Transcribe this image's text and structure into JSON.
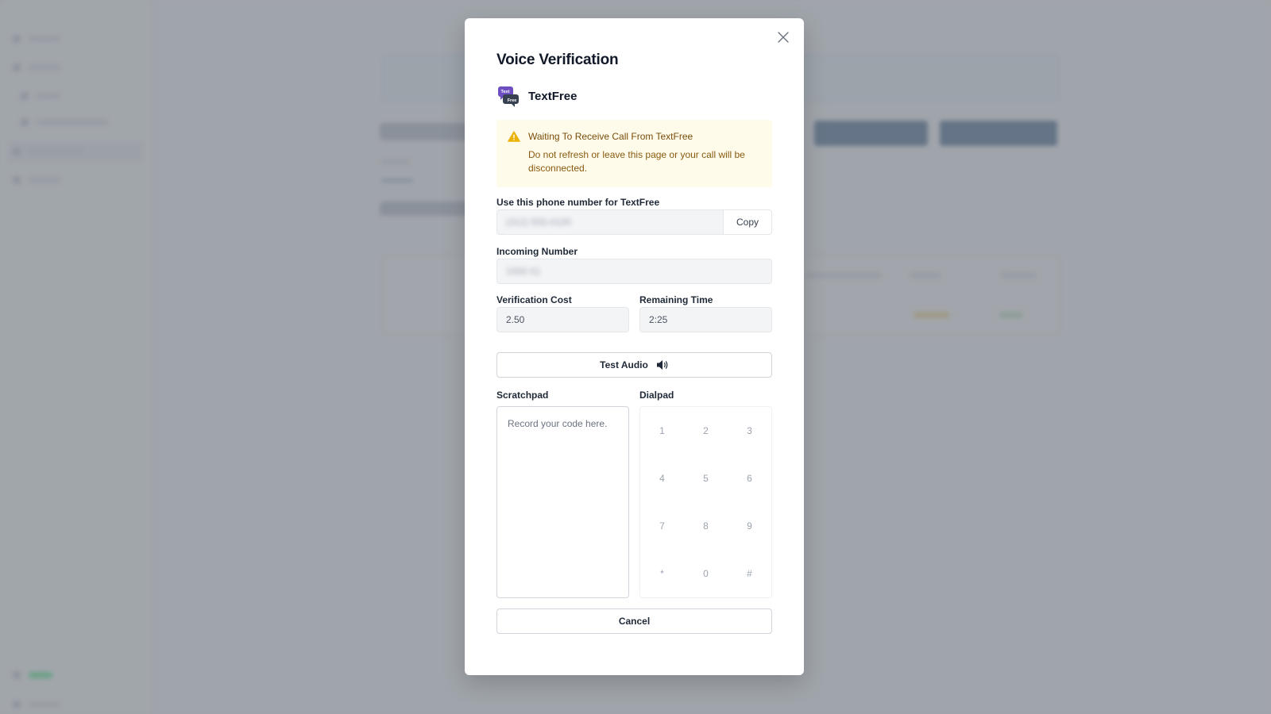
{
  "modal": {
    "title": "Voice Verification",
    "provider": {
      "name": "TextFree",
      "logo_icon": "textfree-logo-icon",
      "logo_text_top": "Text",
      "logo_text_bottom": "Free"
    },
    "alert": {
      "icon": "warning-icon",
      "title": "Waiting To Receive Call From TextFree",
      "body": "Do not refresh or leave this page or your call will be disconnected."
    },
    "phone": {
      "label": "Use this phone number for TextFree",
      "value": "(312) 555-0100",
      "copy_label": "Copy"
    },
    "incoming": {
      "label": "Incoming Number",
      "value": "1000 01"
    },
    "cost": {
      "label": "Verification Cost",
      "value": "2.50"
    },
    "remaining": {
      "label": "Remaining Time",
      "value": "2:25"
    },
    "test_audio": {
      "label": "Test Audio",
      "icon": "speaker-icon"
    },
    "scratchpad": {
      "label": "Scratchpad",
      "placeholder": "Record your code here."
    },
    "dialpad": {
      "label": "Dialpad",
      "keys": [
        "1",
        "2",
        "3",
        "4",
        "5",
        "6",
        "7",
        "8",
        "9",
        "*",
        "0",
        "#"
      ]
    },
    "cancel_label": "Cancel"
  },
  "colors": {
    "alert_bg": "#fefbea",
    "alert_text": "#7a4d0b",
    "warning_icon": "#eab308",
    "logo_purple": "#6d4fc2"
  }
}
